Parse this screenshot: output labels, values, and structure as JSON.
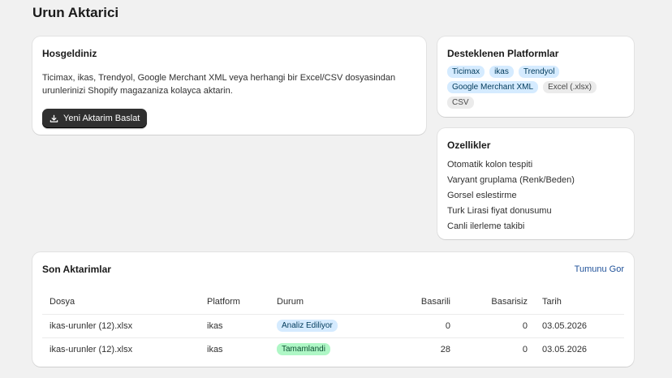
{
  "page": {
    "title": "Urun Aktarici"
  },
  "welcome": {
    "title": "Hosgeldiniz",
    "description": "Ticimax, ikas, Trendyol, Google Merchant XML veya herhangi bir Excel/CSV dosyasindan urunlerinizi Shopify magazaniza kolayca aktarin.",
    "button_label": "Yeni Aktarim Baslat",
    "button_icon": "download-icon"
  },
  "platforms": {
    "title": "Desteklenen Platformlar",
    "badges": [
      {
        "label": "Ticimax",
        "tone": "info"
      },
      {
        "label": "ikas",
        "tone": "info"
      },
      {
        "label": "Trendyol",
        "tone": "info"
      },
      {
        "label": "Google Merchant XML",
        "tone": "info"
      },
      {
        "label": "Excel (.xlsx)",
        "tone": "neutral"
      },
      {
        "label": "CSV",
        "tone": "neutral"
      }
    ]
  },
  "features": {
    "title": "Ozellikler",
    "items": [
      "Otomatik kolon tespiti",
      "Varyant gruplama (Renk/Beden)",
      "Gorsel eslestirme",
      "Turk Lirasi fiyat donusumu",
      "Canli ilerleme takibi"
    ]
  },
  "recent": {
    "title": "Son Aktarimlar",
    "view_all": "Tumunu Gor",
    "columns": [
      "Dosya",
      "Platform",
      "Durum",
      "Basarili",
      "Basarisiz",
      "Tarih"
    ],
    "rows": [
      {
        "file": "ikas-urunler (12).xlsx",
        "platform": "ikas",
        "status": "Analiz Ediliyor",
        "success": "0",
        "failed": "0",
        "date": "03.05.2026"
      },
      {
        "file": "ikas-urunler (12).xlsx",
        "platform": "ikas",
        "status": "Tamamlandi",
        "success": "28",
        "failed": "0",
        "date": "03.05.2026"
      }
    ]
  },
  "colors": {
    "background": "#f1f1f1",
    "primary_button": "#303030",
    "info_badge": "#d5ebff",
    "success_badge": "#aff7c6",
    "neutral_badge": "#ebebeb",
    "link": "#1f5199"
  }
}
